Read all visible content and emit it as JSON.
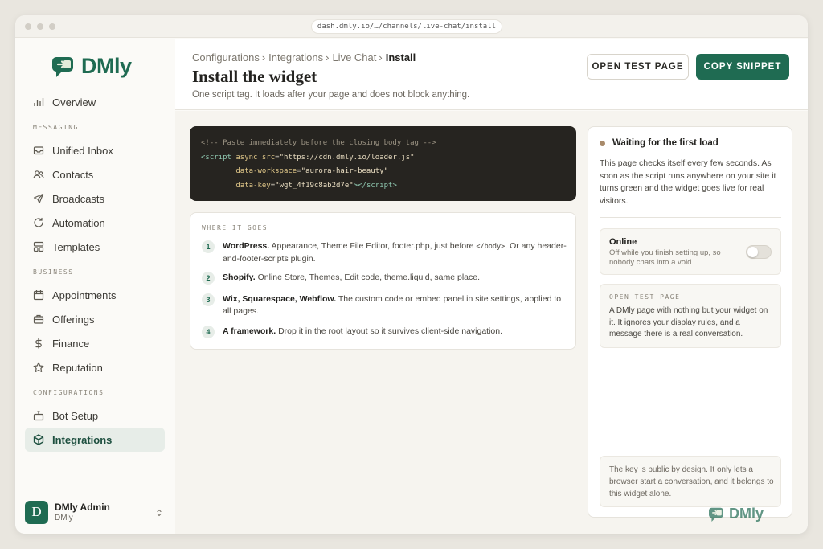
{
  "browser": {
    "url": "dash.dmly.io/…/channels/live-chat/install"
  },
  "brand": {
    "name": "DMly",
    "color": "#1f6b52"
  },
  "sidebar": {
    "overview": "Overview",
    "sections": {
      "messaging": "MESSAGING",
      "business": "BUSINESS",
      "configurations": "CONFIGURATIONS"
    },
    "messaging": [
      "Unified Inbox",
      "Contacts",
      "Broadcasts",
      "Automation",
      "Templates"
    ],
    "business": [
      "Appointments",
      "Offerings",
      "Finance",
      "Reputation"
    ],
    "configurations": [
      "Bot Setup",
      "Integrations"
    ],
    "active": "Integrations"
  },
  "user": {
    "initial": "D",
    "name": "DMly Admin",
    "org": "DMly"
  },
  "header": {
    "breadcrumb": [
      "Configurations",
      "Integrations",
      "Live Chat",
      "Install"
    ],
    "title": "Install the widget",
    "subtitle": "One script tag. It loads after your page and does not block anything.",
    "open_test_label": "OPEN TEST PAGE",
    "copy_snippet_label": "COPY SNIPPET"
  },
  "snippet": {
    "comment": "<!-- Paste immediately before the closing body tag -->",
    "src": "https://cdn.dmly.io/loader.js",
    "workspace": "aurora-hair-beauty",
    "key": "wgt_4f19c8ab2d7e"
  },
  "where": {
    "heading": "WHERE IT GOES",
    "steps": [
      {
        "num": "1",
        "title": "WordPress.",
        "text_a": "Appearance, Theme File Editor, footer.php, just before ",
        "code": "</body>",
        "text_b": ". Or any header-and-footer-scripts plugin."
      },
      {
        "num": "2",
        "title": "Shopify.",
        "text": "Online Store, Themes, Edit code, theme.liquid, same place."
      },
      {
        "num": "3",
        "title": "Wix, Squarespace, Webflow.",
        "text": "The custom code or embed panel in site settings, applied to all pages."
      },
      {
        "num": "4",
        "title": "A framework.",
        "text": "Drop it in the root layout so it survives client-side navigation."
      }
    ]
  },
  "status": {
    "title": "Waiting for the first load",
    "dot_color": "#a88a6a",
    "description": "This page checks itself every few seconds. As soon as the script runs anywhere on your site it turns green and the widget goes live for real visitors.",
    "online_title": "Online",
    "online_desc": "Off while you finish setting up, so nobody chats into a void.",
    "online_on": false,
    "test_heading": "OPEN TEST PAGE",
    "test_desc": "A DMly page with nothing but your widget on it. It ignores your display rules, and a message there is a real conversation.",
    "note": "The key is public by design. It only lets a browser start a conversation, and it belongs to this widget alone."
  }
}
